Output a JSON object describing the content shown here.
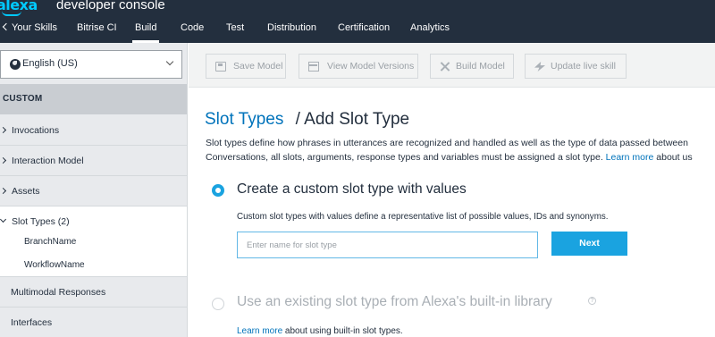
{
  "header": {
    "logo_text": "alexa",
    "app_name": "developer console",
    "nav": [
      {
        "label": "Your Skills"
      },
      {
        "label": "Bitrise CI"
      },
      {
        "label": "Build"
      },
      {
        "label": "Code"
      },
      {
        "label": "Test"
      },
      {
        "label": "Distribution"
      },
      {
        "label": "Certification"
      },
      {
        "label": "Analytics"
      }
    ],
    "active_tab": "Build"
  },
  "sidebar": {
    "locale": "English (US)",
    "section": "CUSTOM",
    "items": [
      {
        "label": "Invocations"
      },
      {
        "label": "Interaction Model"
      },
      {
        "label": "Assets"
      },
      {
        "label": "Slot Types (2)"
      },
      {
        "label": "BranchName"
      },
      {
        "label": "WorkflowName"
      },
      {
        "label": "Multimodal Responses"
      },
      {
        "label": "Interfaces"
      }
    ]
  },
  "toolbar": {
    "save": "Save Model",
    "versions": "View Model Versions",
    "build": "Build Model",
    "update": "Update live skill"
  },
  "main": {
    "breadcrumb": "Slot Types",
    "separator": "/",
    "title": "Add Slot Type",
    "desc_line1": "Slot types define how phrases in utterances are recognized and handled as well as the type of data passed between",
    "desc_line2_pre": "Conversations, all slots, arguments, response types and variables must be assigned a slot type.",
    "desc_link": "Learn more",
    "desc_line2_post": "about us",
    "option_custom": {
      "label": "Create a custom slot type with values",
      "selected": true,
      "hint": "Custom slot types with values define a representative list of possible values, IDs and synonyms.",
      "input_placeholder": "Enter name for slot type",
      "input_value": "",
      "next_label": "Next"
    },
    "option_builtin": {
      "label": "Use an existing slot type from Alexa's built-in library",
      "selected": false,
      "help": "?",
      "learn_link": "Learn more",
      "learn_text": "about using built-in slot types."
    }
  },
  "colors": {
    "topbar": "#232f3e",
    "accent": "#1aa3e0",
    "link": "#0073bb",
    "logo": "#00caff"
  }
}
